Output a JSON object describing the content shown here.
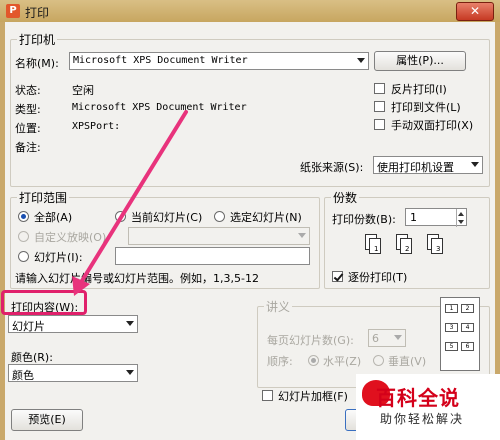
{
  "window": {
    "title": "打印",
    "close": "✕"
  },
  "printer": {
    "group_title": "打印机",
    "name_label": "名称(M):",
    "name_value": "Microsoft XPS Document Writer",
    "properties_button": "属性(P)...",
    "status_label": "状态:",
    "status_value": "空闲",
    "type_label": "类型:",
    "type_value": "Microsoft XPS Document Writer",
    "location_label": "位置:",
    "location_value": "XPSPort:",
    "comment_label": "备注:",
    "reverse_print": "反片打印(I)",
    "print_to_file": "打印到文件(L)",
    "manual_duplex": "手动双面打印(X)",
    "paper_source_label": "纸张来源(S):",
    "paper_source_value": "使用打印机设置"
  },
  "range": {
    "group_title": "打印范围",
    "all": "全部(A)",
    "current_slide": "当前幻灯片(C)",
    "selected_slides": "选定幻灯片(N)",
    "custom_show": "自定义放映(O):",
    "slides": "幻灯片(I):",
    "hint": "请输入幻灯片编号或幻灯片范围。例如，1,3,5-12"
  },
  "copies": {
    "group_title": "份数",
    "count_label": "打印份数(B):",
    "count_value": "1",
    "collate": "逐份打印(T)",
    "page_numbers": [
      "1",
      "2",
      "3"
    ]
  },
  "content": {
    "label": "打印内容(W):",
    "value": "幻灯片",
    "color_label": "颜色(R):",
    "color_value": "颜色",
    "frame_slides": "幻灯片加框(F)"
  },
  "handouts": {
    "group_title": "讲义",
    "per_page_label": "每页幻灯片数(G):",
    "per_page_value": "6",
    "order_label": "顺序:",
    "horizontal": "水平(Z)",
    "vertical": "垂直(V)",
    "preview_numbers": [
      "1",
      "2",
      "3",
      "4",
      "5",
      "6"
    ]
  },
  "buttons": {
    "preview": "预览(E)",
    "ok": "确"
  },
  "watermark": {
    "big": "百科全说",
    "small": "助你轻松解决"
  },
  "colors": {
    "highlight": "#e0206b",
    "titlebar": "#c9a86a"
  }
}
